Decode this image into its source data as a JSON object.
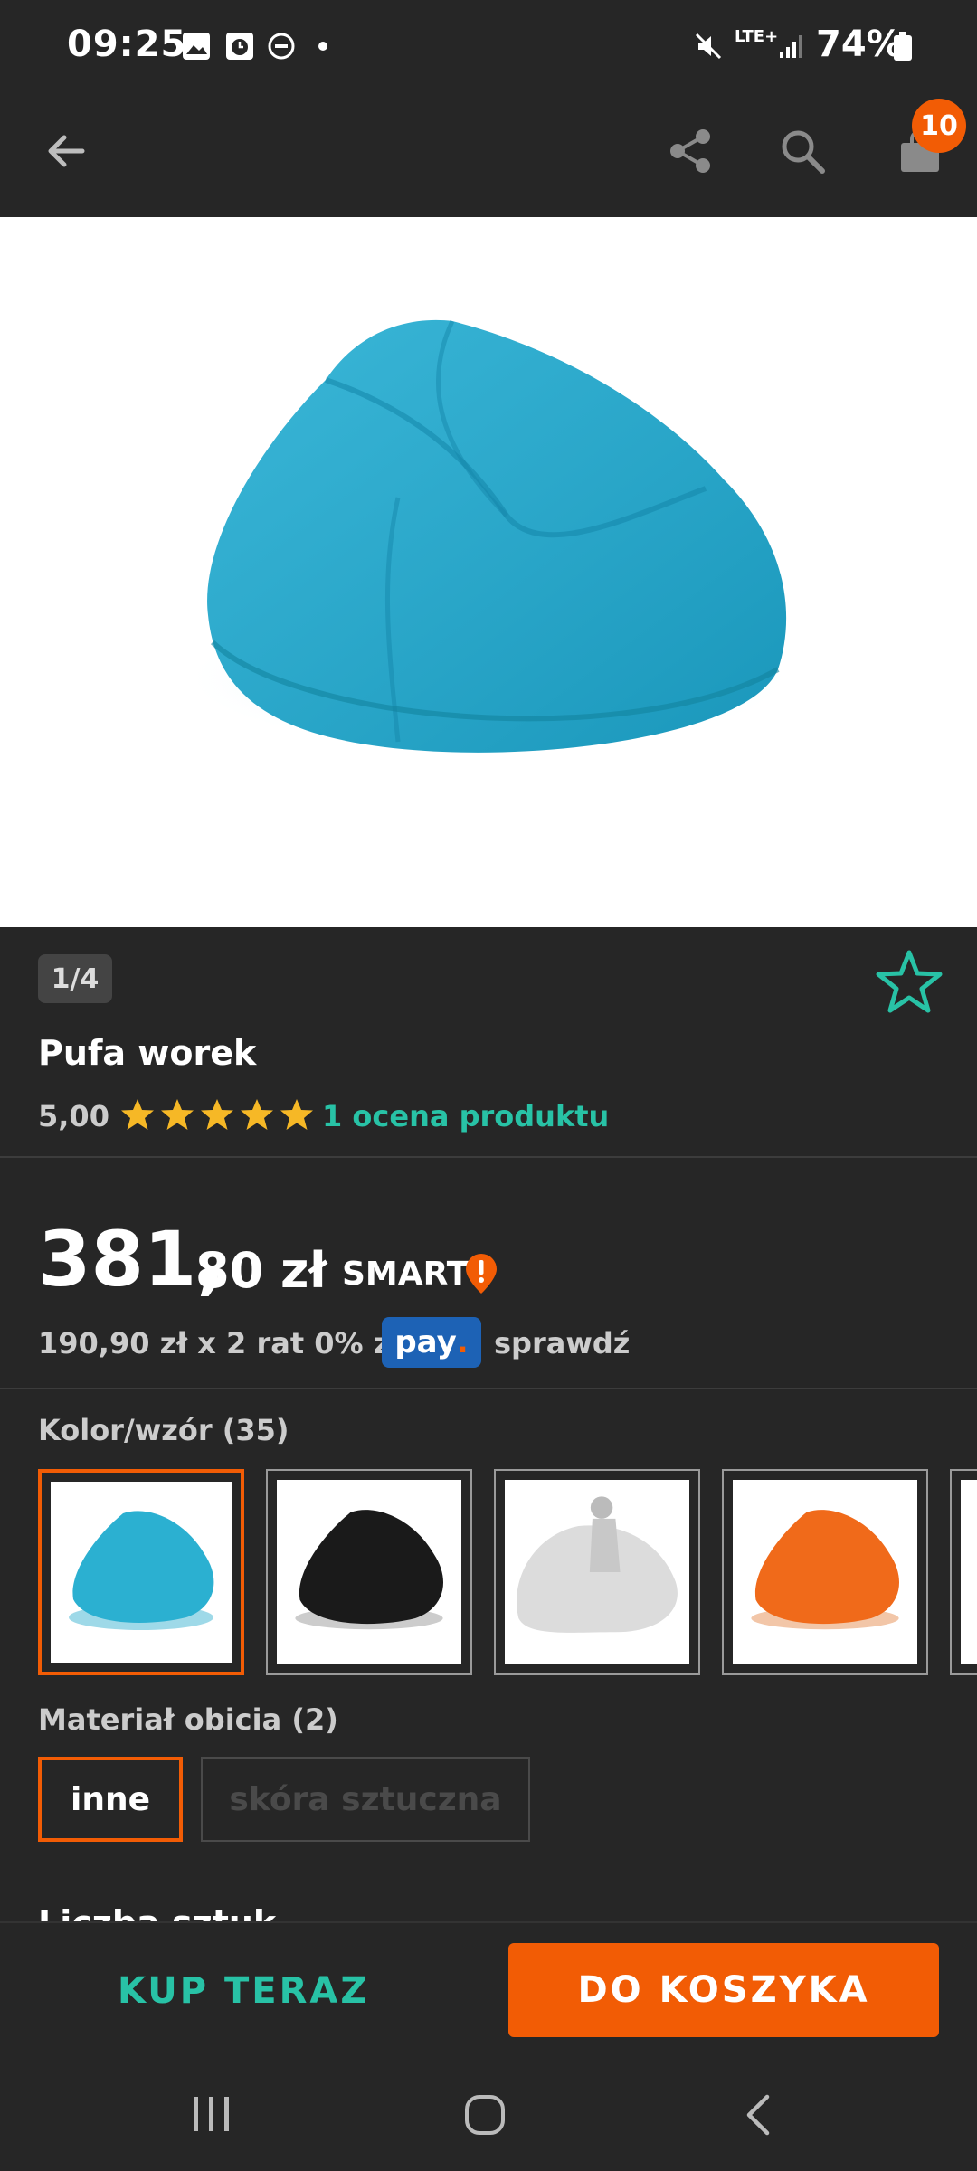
{
  "status_bar": {
    "time": "09:25",
    "network": "LTE+",
    "battery": "74%",
    "icons": [
      "gallery-icon",
      "alarm-icon",
      "dnd-icon",
      "dot-icon",
      "mute-icon",
      "signal-icon",
      "battery-icon"
    ]
  },
  "app_bar": {
    "icons": [
      "back-arrow-icon",
      "share-icon",
      "search-icon",
      "cart-icon"
    ],
    "cart_count": "10"
  },
  "gallery": {
    "counter": "1/4"
  },
  "product": {
    "title": "Pufa worek",
    "rating_value": "5,00",
    "rating_stars": 5,
    "rating_link": "1 ocena produktu",
    "price_integer": "381,",
    "price_decimal": "80 zł",
    "smart_label": "SMART",
    "installment_text": "190,90 zł x 2 rat 0% z",
    "pay_logo": "pay",
    "pay_dot": ".",
    "check_link": "sprawdź"
  },
  "color": {
    "label": "Kolor/wzór (35)",
    "swatches": [
      {
        "name": "turkusowy",
        "color": "#2bb0d1"
      },
      {
        "name": "czarny",
        "color": "#1a1a1a"
      },
      {
        "name": "jasnoszary",
        "color": "#dcdcdc"
      },
      {
        "name": "pomarańczowy",
        "color": "#f06a1a"
      }
    ]
  },
  "material": {
    "label": "Materiał obicia (2)",
    "options": [
      "inne",
      "skóra sztuczna"
    ]
  },
  "quantity": {
    "label": "Liczba sztuk"
  },
  "actions": {
    "buy_now": "KUP TERAZ",
    "add_to_cart": "DO KOSZYKA"
  },
  "colors": {
    "accent_orange": "#f25c05",
    "accent_teal": "#28c2a6",
    "star_yellow": "#f6b826",
    "background": "#262626"
  }
}
